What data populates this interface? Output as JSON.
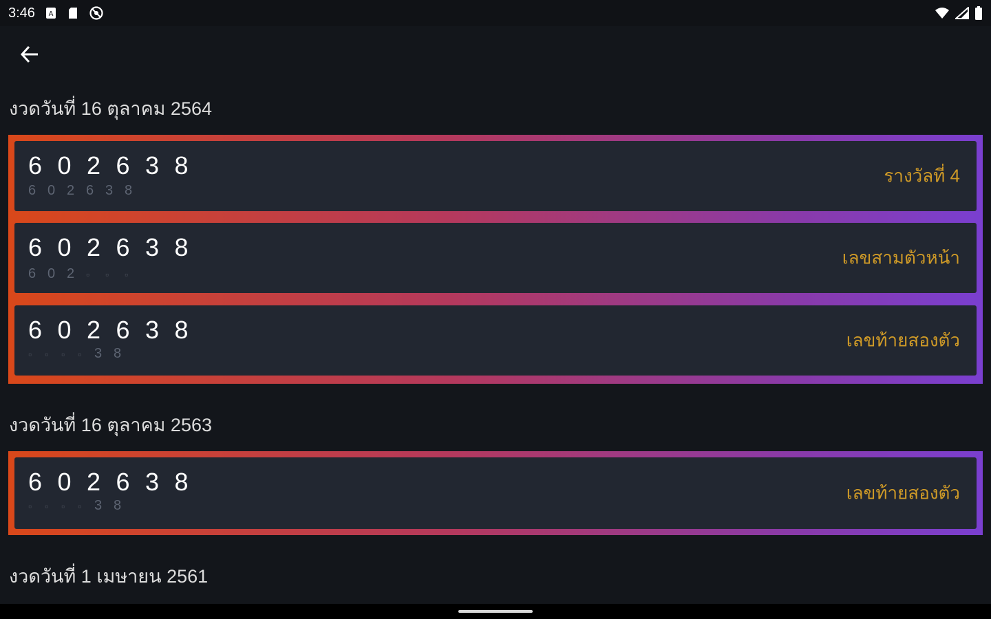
{
  "status_bar": {
    "time": "3:46",
    "left_icons": [
      "sim-icon",
      "sd-card-icon",
      "blocked-icon"
    ],
    "right_icons": [
      "wifi-icon",
      "cell-signal-icon",
      "battery-icon"
    ]
  },
  "app_bar": {
    "back_icon": "arrow-back-icon"
  },
  "groups": [
    {
      "title": "งวดวันที่ 16 ตุลาคม 2564",
      "entries": [
        {
          "digits": [
            "6",
            "0",
            "2",
            "6",
            "3",
            "8"
          ],
          "match": [
            "6",
            "0",
            "2",
            "6",
            "3",
            "8"
          ],
          "prize": "รางวัลที่ 4"
        },
        {
          "digits": [
            "6",
            "0",
            "2",
            "6",
            "3",
            "8"
          ],
          "match": [
            "6",
            "0",
            "2",
            "▫",
            "▫",
            "▫"
          ],
          "prize": "เลขสามตัวหน้า"
        },
        {
          "digits": [
            "6",
            "0",
            "2",
            "6",
            "3",
            "8"
          ],
          "match": [
            "▫",
            "▫",
            "▫",
            "▫",
            "3",
            "8"
          ],
          "prize": "เลขท้ายสองตัว"
        }
      ]
    },
    {
      "title": "งวดวันที่ 16 ตุลาคม 2563",
      "entries": [
        {
          "digits": [
            "6",
            "0",
            "2",
            "6",
            "3",
            "8"
          ],
          "match": [
            "▫",
            "▫",
            "▫",
            "▫",
            "3",
            "8"
          ],
          "prize": "เลขท้ายสองตัว"
        }
      ]
    },
    {
      "title": "งวดวันที่ 1 เมษายน 2561",
      "entries": []
    }
  ],
  "colors": {
    "background": "#13161b",
    "card": "#222731",
    "prize_text": "#cf9a27",
    "gradient_start": "#d9481a",
    "gradient_end": "#7a3fd0"
  }
}
